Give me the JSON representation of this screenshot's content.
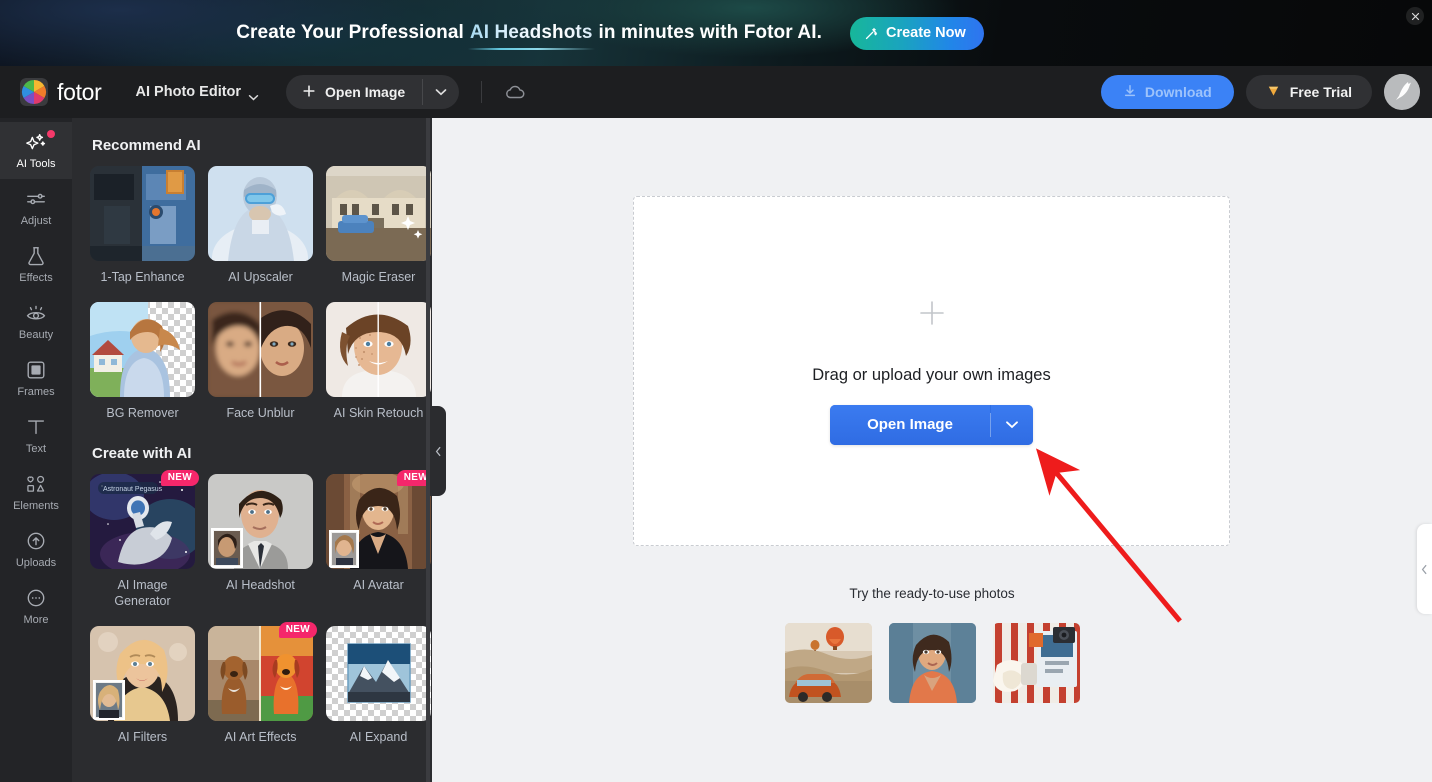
{
  "banner": {
    "text_before": "Create Your Professional ",
    "highlight": "AI Headshots",
    "text_after": " in minutes with Fotor AI.",
    "cta_label": "Create Now",
    "cta_icon": "magic-wand-icon",
    "close_icon": "close-icon",
    "gradient_from": "#17b79a",
    "gradient_to": "#2f74f0"
  },
  "toolbar": {
    "logo_text": "fotor",
    "logo_icon": "fotor-color-wheel-logo",
    "app_switcher_label": "AI Photo Editor",
    "app_switcher_icon": "chevron-down-icon",
    "open_image_label": "Open Image",
    "open_image_icon": "plus-icon",
    "open_image_caret_icon": "chevron-down-icon",
    "cloud_icon": "cloud-icon",
    "download_label": "Download",
    "download_icon": "download-icon",
    "download_color": "#3b82f6",
    "free_trial_label": "Free Trial",
    "free_trial_icon": "diamond-icon",
    "avatar_icon": "bird-avatar-icon"
  },
  "sidebar": {
    "items": [
      {
        "label": "AI Tools",
        "icon": "sparkles-icon",
        "active": true,
        "badge": true
      },
      {
        "label": "Adjust",
        "icon": "sliders-icon",
        "active": false,
        "badge": false
      },
      {
        "label": "Effects",
        "icon": "flask-icon",
        "active": false,
        "badge": false
      },
      {
        "label": "Beauty",
        "icon": "eye-icon",
        "active": false,
        "badge": false
      },
      {
        "label": "Frames",
        "icon": "frame-icon",
        "active": false,
        "badge": false
      },
      {
        "label": "Text",
        "icon": "text-t-icon",
        "active": false,
        "badge": false
      },
      {
        "label": "Elements",
        "icon": "shapes-icon",
        "active": false,
        "badge": false
      },
      {
        "label": "Uploads",
        "icon": "upload-cloud-icon",
        "active": false,
        "badge": false
      },
      {
        "label": "More",
        "icon": "ellipsis-icon",
        "active": false,
        "badge": false
      }
    ]
  },
  "panel": {
    "collapse_icon": "chevron-left-icon",
    "sections": [
      {
        "title": "Recommend AI",
        "rows": [
          [
            {
              "label": "1-Tap Enhance",
              "thumb": "city-street-before-after",
              "new": false
            },
            {
              "label": "AI Upscaler",
              "thumb": "skier-portrait",
              "new": false
            },
            {
              "label": "Magic Eraser",
              "thumb": "mansion-car-erase",
              "new": false
            }
          ],
          [
            {
              "label": "BG Remover",
              "thumb": "woman-bg-removed",
              "new": false
            },
            {
              "label": "Face Unblur",
              "thumb": "face-blur-compare",
              "new": false
            },
            {
              "label": "AI Skin Retouch",
              "thumb": "skin-retouch-compare",
              "new": false
            }
          ]
        ]
      },
      {
        "title": "Create with AI",
        "rows": [
          [
            {
              "label": "AI Image Generator",
              "thumb": "astronaut-pegasus",
              "new": true,
              "new_label": "NEW"
            },
            {
              "label": "AI Headshot",
              "thumb": "man-suit-headshot",
              "new": false
            },
            {
              "label": "AI Avatar",
              "thumb": "woman-gown-avatar",
              "new": true,
              "new_label": "NEW"
            }
          ],
          [
            {
              "label": "AI Filters",
              "thumb": "blonde-woman-filter",
              "new": false
            },
            {
              "label": "AI Art Effects",
              "thumb": "dog-art-compare",
              "new": true,
              "new_label": "NEW"
            },
            {
              "label": "AI Expand",
              "thumb": "mountain-expand",
              "new": false
            }
          ]
        ]
      }
    ]
  },
  "canvas": {
    "dropzone": {
      "plus_icon": "plus-icon",
      "prompt": "Drag or upload your own images",
      "cta_label": "Open Image",
      "cta_caret_icon": "chevron-down-icon",
      "cta_color": "#2f6fe4",
      "highlight_color": "#ee1c1c"
    },
    "ready_title": "Try the ready-to-use photos",
    "ready_photos": [
      {
        "name": "balloons-and-car-photo"
      },
      {
        "name": "woman-portrait-photo"
      },
      {
        "name": "striped-flatlay-photo"
      }
    ],
    "collapse_icon": "chevron-left-icon",
    "annotation": {
      "type": "arrow",
      "color": "#ee1c1c",
      "points": "1180,620 -> 1040,455"
    }
  }
}
